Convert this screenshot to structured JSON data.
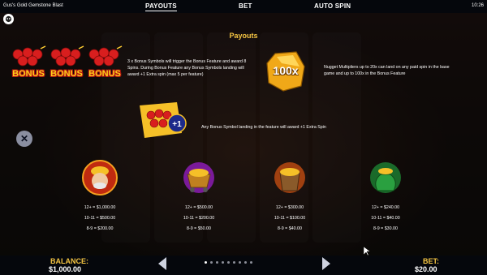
{
  "window": {
    "title": "Gus's Gold Gemstone Blast",
    "clock": "10:26"
  },
  "tabs": [
    {
      "label": "PAYOUTS",
      "active": true
    },
    {
      "label": "BET",
      "active": false
    },
    {
      "label": "AUTO SPIN",
      "active": false
    }
  ],
  "section_title": "Payouts",
  "bonus": {
    "symbol_label": "BONUS",
    "description_lines": [
      "3 x Bonus Symbols will trigger the Bonus Feature and award 8",
      "Spins. During Bonus Feature any Bonus Symbols landing will",
      "award +1 Extra spin (max 5 per feature)"
    ]
  },
  "nugget": {
    "multiplier_label": "100x",
    "description_lines": [
      "Nugget Multipliers up to 20x can land on any paid spin in the base",
      "game and up to 100x in the Bonus Feature"
    ]
  },
  "extra_spin": {
    "badge": "+1",
    "description": "Any Bonus Symbol landing in the feature will award +1 Extra Spin"
  },
  "payouts": [
    {
      "icon": "gus-miner-icon",
      "lines": [
        "12+ = $1,000.00",
        "10-11 = $500.00",
        "8-9 = $200.00"
      ]
    },
    {
      "icon": "gold-cart-icon",
      "lines": [
        "12+ = $500.00",
        "10-11 = $200.00",
        "8-9 = $50.00"
      ]
    },
    {
      "icon": "gold-bucket-icon",
      "lines": [
        "12+ = $300.00",
        "10-11 = $100.00",
        "8-9 = $40.00"
      ]
    },
    {
      "icon": "gold-sack-icon",
      "lines": [
        "12+ = $240.00",
        "10-11 = $40.00",
        "8-9 = $30.00"
      ]
    }
  ],
  "footer": {
    "balance_label": "BALANCE:",
    "balance_value": "$1,000.00",
    "bet_label": "BET:",
    "bet_value": "$20.00",
    "page_count": 9,
    "current_page": 1
  },
  "colors": {
    "accent_gold": "#f5c542",
    "bonus_red": "#d81e1e",
    "panel_dark": "#05070c"
  }
}
